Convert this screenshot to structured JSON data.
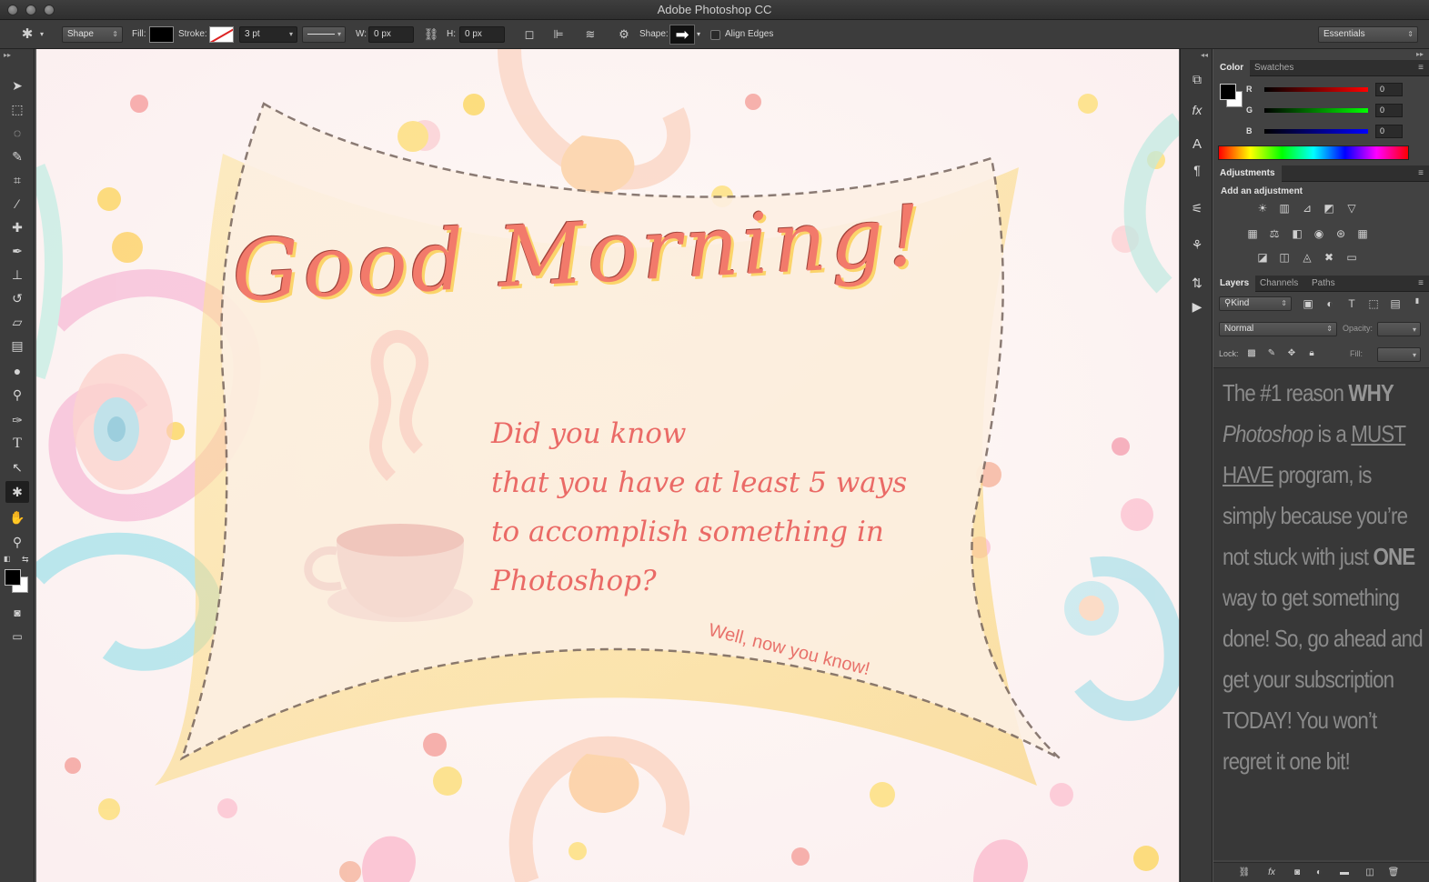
{
  "window": {
    "title": "Adobe Photoshop CC"
  },
  "options_bar": {
    "tool_mode": "Shape",
    "fill_label": "Fill:",
    "stroke_label": "Stroke:",
    "stroke_width": "3 pt",
    "w_label": "W:",
    "w_value": "0 px",
    "h_label": "H:",
    "h_value": "0 px",
    "shape_label": "Shape:",
    "align_edges_label": "Align Edges",
    "workspace": "Essentials"
  },
  "canvas": {
    "headline": "Good Morning!",
    "question_lines": [
      "Did you know",
      "that you have at least 5 ways",
      "to accomplish something in",
      "Photoshop?"
    ],
    "footer": "Well, now you know!"
  },
  "color_panel": {
    "tabs": [
      "Color",
      "Swatches"
    ],
    "channels": [
      {
        "label": "R",
        "value": "0"
      },
      {
        "label": "G",
        "value": "0"
      },
      {
        "label": "B",
        "value": "0"
      }
    ]
  },
  "adjustments_panel": {
    "tab": "Adjustments",
    "heading": "Add an adjustment"
  },
  "layers_panel": {
    "tabs": [
      "Layers",
      "Channels",
      "Paths"
    ],
    "filter_kind": "Kind",
    "blend_mode": "Normal",
    "opacity_label": "Opacity:",
    "lock_label": "Lock:",
    "fill_label": "Fill:",
    "text_parts": {
      "p1": "The #1 reason ",
      "p2": "WHY",
      "p3": "Photoshop",
      "p4": " is a ",
      "p5": "MUST HAVE",
      "p6": " program, is simply because you’re not stuck with just ",
      "p7": "ONE",
      "p8": " way to get something done! So, go ahead and get your subscription TODAY! You won’t regret it one bit!"
    }
  }
}
